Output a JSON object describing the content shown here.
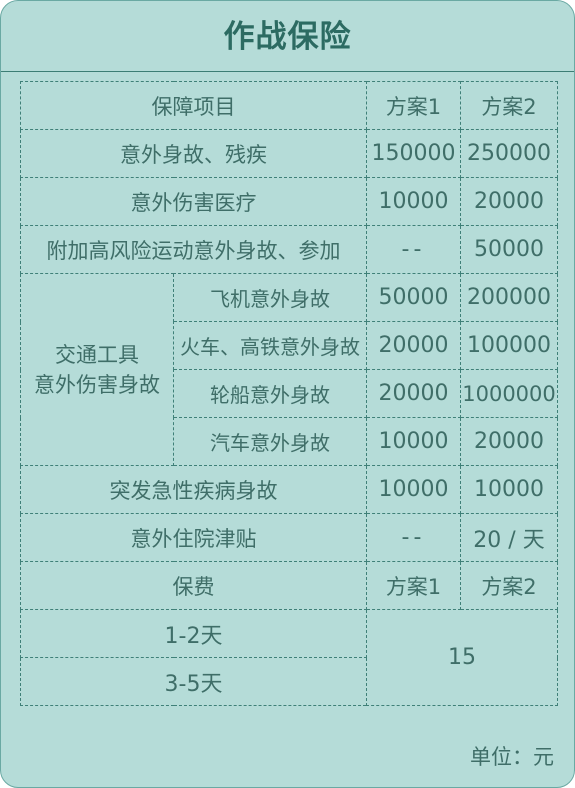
{
  "title": "作战保险",
  "unit_note": "单位：元",
  "header": {
    "item": "保障项目",
    "plan1": "方案1",
    "plan2": "方案2"
  },
  "rows": [
    {
      "label": "意外身故、残疾",
      "plan1": "150000",
      "plan2": "250000"
    },
    {
      "label": "意外伤害医疗",
      "plan1": "10000",
      "plan2": "20000"
    },
    {
      "label": "附加高风险运动意外身故、参加",
      "plan1": "--",
      "plan2": "50000"
    }
  ],
  "transport": {
    "group_label_line1": "交通工具",
    "group_label_line2": "意外伤害身故",
    "items": [
      {
        "label": "飞机意外身故",
        "plan1": "50000",
        "plan2": "200000"
      },
      {
        "label": "火车、高铁意外身故",
        "plan1": "20000",
        "plan2": "100000"
      },
      {
        "label": "轮船意外身故",
        "plan1": "20000",
        "plan2": "1000000"
      },
      {
        "label": "汽车意外身故",
        "plan1": "10000",
        "plan2": "20000"
      }
    ]
  },
  "rows_after": [
    {
      "label": "突发急性疾病身故",
      "plan1": "10000",
      "plan2": "10000"
    },
    {
      "label": "意外住院津贴",
      "plan1": "--",
      "plan2": "20 / 天"
    }
  ],
  "premium": {
    "header": "保费",
    "plan1": "方案1",
    "plan2": "方案2",
    "tiers": [
      "1-2天",
      "3-5天"
    ],
    "value": "15"
  }
}
